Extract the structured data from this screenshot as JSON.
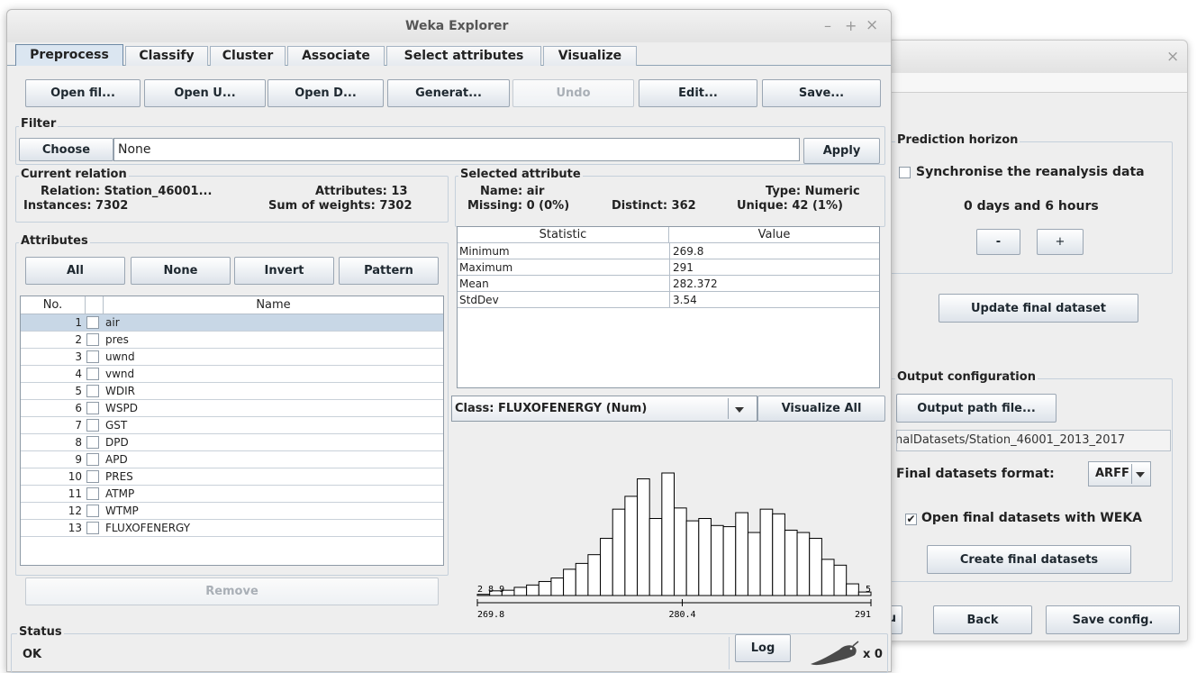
{
  "bg_window": {
    "close_glyph": "×",
    "prediction_horizon": {
      "title": "Prediction horizon",
      "sync_label": "Synchronise the reanalysis data",
      "sync_checked": false,
      "horizon_text": "0 days and 6 hours",
      "minus_label": "-",
      "plus_label": "+"
    },
    "update_button": "Update final dataset",
    "output_config": {
      "title": "Output configuration",
      "path_button": "Output path file...",
      "path_value": "nalDatasets/Station_46001_2013_2017",
      "format_label": "Final datasets format:",
      "format_value": "ARFF",
      "open_weka_label": "Open final datasets with WEKA",
      "open_weka_checked": true,
      "create_button": "Create final datasets"
    },
    "partial_button_label": "u",
    "back_button": "Back",
    "save_config_button": "Save config."
  },
  "weka": {
    "title": "Weka Explorer",
    "window_controls": [
      "–",
      "+",
      "×"
    ],
    "tabs": [
      "Preprocess",
      "Classify",
      "Cluster",
      "Associate",
      "Select attributes",
      "Visualize"
    ],
    "toolbar": [
      "Open fil...",
      "Open U...",
      "Open D...",
      "Generat...",
      "Undo",
      "Edit...",
      "Save..."
    ],
    "filter": {
      "title": "Filter",
      "choose_label": "Choose",
      "value": "None",
      "apply_label": "Apply"
    },
    "current_relation": {
      "title": "Current relation",
      "relation": "Relation: Station_46001...",
      "attributes": "Attributes: 13",
      "instances": "Instances: 7302",
      "sum_weights": "Sum of weights: 7302"
    },
    "attributes": {
      "title": "Attributes",
      "buttons": [
        "All",
        "None",
        "Invert",
        "Pattern"
      ],
      "col_no": "No.",
      "col_name": "Name",
      "rows": [
        {
          "no": "1",
          "name": "air"
        },
        {
          "no": "2",
          "name": "pres"
        },
        {
          "no": "3",
          "name": "uwnd"
        },
        {
          "no": "4",
          "name": "vwnd"
        },
        {
          "no": "5",
          "name": "WDIR"
        },
        {
          "no": "6",
          "name": "WSPD"
        },
        {
          "no": "7",
          "name": "GST"
        },
        {
          "no": "8",
          "name": "DPD"
        },
        {
          "no": "9",
          "name": "APD"
        },
        {
          "no": "10",
          "name": "PRES"
        },
        {
          "no": "11",
          "name": "ATMP"
        },
        {
          "no": "12",
          "name": "WTMP"
        },
        {
          "no": "13",
          "name": "FLUXOFENERGY"
        }
      ],
      "remove_label": "Remove"
    },
    "selected_attribute": {
      "title": "Selected attribute",
      "name": "Name: air",
      "type": "Type: Numeric",
      "missing": "Missing: 0 (0%)",
      "distinct": "Distinct: 362",
      "unique": "Unique: 42 (1%)",
      "col_stat": "Statistic",
      "col_value": "Value",
      "stats": [
        {
          "stat": "Minimum",
          "value": "269.8"
        },
        {
          "stat": "Maximum",
          "value": "291"
        },
        {
          "stat": "Mean",
          "value": "282.372"
        },
        {
          "stat": "StdDev",
          "value": "3.54"
        }
      ]
    },
    "class_select": "Class: FLUXOFENERGY (Num)",
    "visualize_all": "Visualize All",
    "histogram": {
      "min_label": "269.8",
      "mid_label": "280.4",
      "max_label": "291",
      "left_counts": "2 8 9",
      "right_count": "5"
    },
    "status": {
      "title": "Status",
      "text": "OK",
      "log_label": "Log",
      "count": "x 0"
    }
  },
  "chart_data": {
    "type": "bar",
    "title": "",
    "xlim": [
      269.8,
      291
    ],
    "x_ticks": [
      "269.8",
      "280.4",
      "291"
    ],
    "values": [
      2,
      8,
      9,
      14,
      18,
      24,
      30,
      45,
      55,
      70,
      98,
      148,
      170,
      200,
      132,
      210,
      150,
      128,
      132,
      120,
      118,
      142,
      108,
      148,
      140,
      112,
      108,
      98,
      62,
      52,
      20,
      6
    ]
  }
}
